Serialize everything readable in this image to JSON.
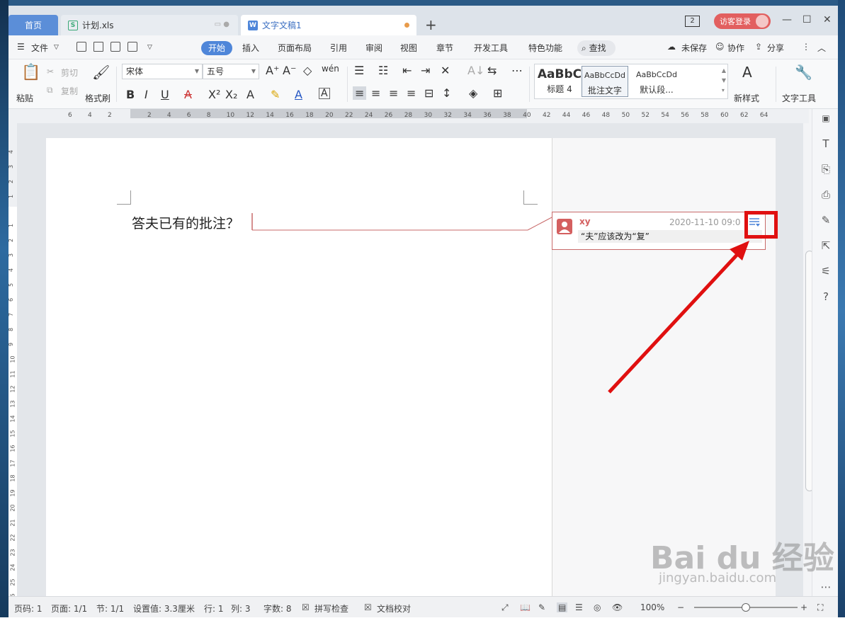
{
  "tabs": {
    "home": "首页",
    "xls": "计划.xls",
    "doc": "文字文稿1",
    "new_tab": "+"
  },
  "titlebar": {
    "count_badge": "2",
    "login": "访客登录"
  },
  "menu": {
    "file": "文件",
    "start": "开始",
    "insert": "插入",
    "layout": "页面布局",
    "references": "引用",
    "review": "审阅",
    "view": "视图",
    "chapter": "章节",
    "devtools": "开发工具",
    "features": "特色功能",
    "search": "查找",
    "unsaved": "未保存",
    "collab": "协作",
    "share": "分享"
  },
  "ribbon": {
    "paste": "粘贴",
    "cut": "剪切",
    "copy": "复制",
    "format_painter": "格式刷",
    "font": "宋体",
    "size": "五号",
    "style_heading4_sample": "AaBbC",
    "style_heading4": "标题 4",
    "style_comment_sample": "AaBbCcDd",
    "style_comment": "批注文字",
    "style_default_sample": "AaBbCcDd",
    "style_default": "默认段...",
    "new_style": "新样式",
    "text_tools": "文字工具"
  },
  "ruler": {
    "left_numbers": [
      "6",
      "4",
      "2"
    ],
    "main_numbers": [
      "2",
      "4",
      "6",
      "8",
      "10",
      "12",
      "14",
      "16",
      "18",
      "20",
      "22",
      "24",
      "26",
      "28",
      "30",
      "32",
      "34",
      "36",
      "38",
      "40",
      "42",
      "44",
      "46",
      "48",
      "50",
      "52",
      "54",
      "56",
      "58",
      "60",
      "62",
      "64"
    ],
    "vertical_top": [
      "4",
      "3",
      "2",
      "1"
    ],
    "vertical_main": [
      "1",
      "2",
      "3",
      "4",
      "5",
      "6",
      "7",
      "8",
      "9",
      "10",
      "11",
      "12",
      "13",
      "14",
      "15",
      "16",
      "17",
      "18",
      "19",
      "20",
      "21",
      "22",
      "23",
      "24",
      "25",
      "26"
    ]
  },
  "document": {
    "text": "答夫已有的批注？"
  },
  "comment": {
    "user": "xy",
    "timestamp": "2020-11-10 09:0",
    "body": "“夫”应该改为“复”"
  },
  "status": {
    "page_no": "页码: 1",
    "pages": "页面: 1/1",
    "section": "节: 1/1",
    "setting": "设置值: 3.3厘米",
    "row": "行: 1",
    "col": "列: 3",
    "words": "字数: 8",
    "spellcheck": "拼写检查",
    "proofread": "文档校对",
    "zoom": "100%",
    "zoom_level": 0.5
  },
  "watermark": {
    "brand": "Bai du 经验",
    "url": "jingyan.baidu.com"
  },
  "colors": {
    "accent": "#4f86d9",
    "highlight": "#e01010",
    "comment_border": "#c86a6a"
  }
}
